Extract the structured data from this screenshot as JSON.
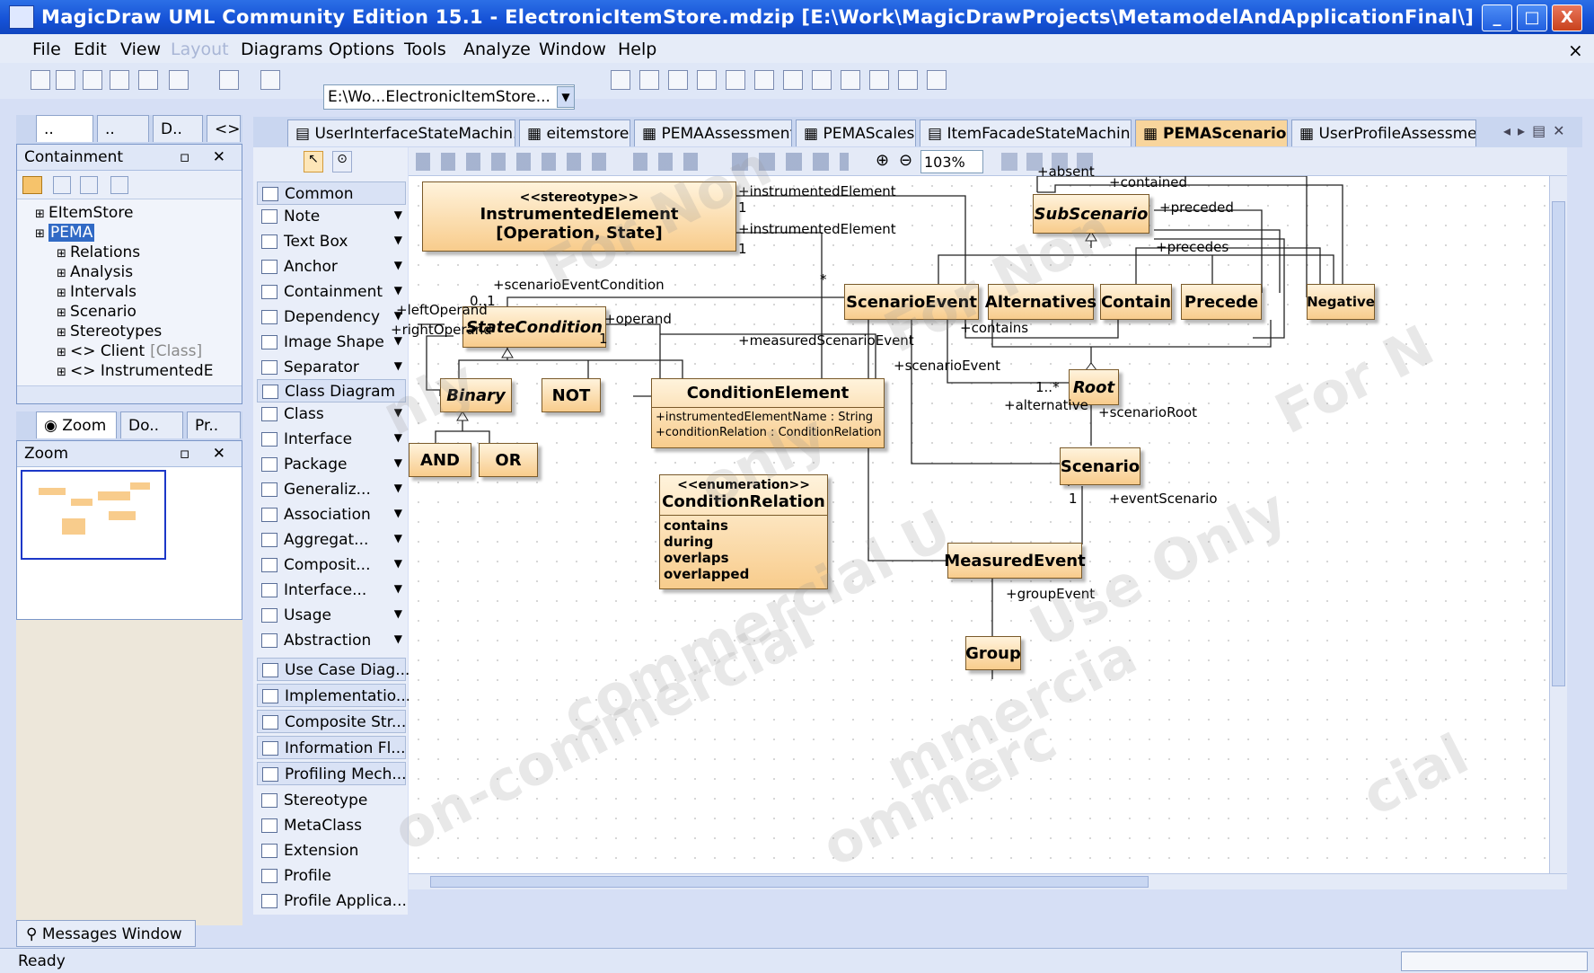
{
  "window": {
    "title": "MagicDraw UML Community Edition 15.1 - ElectronicItemStore.mdzip [E:\\Work\\MagicDrawProjects\\MetamodelAndApplicationFinal\\]",
    "minimize": "_",
    "maximize": "□",
    "close": "X"
  },
  "menu": [
    "File",
    "Edit",
    "View",
    "Layout",
    "Diagrams",
    "Options",
    "Tools",
    "Analyze",
    "Window",
    "Help"
  ],
  "menu_close": "×",
  "toolbar": {
    "project_path": "E:\\Wo...ElectronicItemStore..."
  },
  "left_tabs": [
    "..",
    "..",
    "D..",
    "<>"
  ],
  "containment": {
    "title": "Containment",
    "tree": [
      {
        "indent": 0,
        "label": "EItemStore",
        "selected": false
      },
      {
        "indent": 0,
        "label": "PEMA",
        "selected": true
      },
      {
        "indent": 1,
        "label": "Relations",
        "selected": false
      },
      {
        "indent": 1,
        "label": "Analysis",
        "selected": false
      },
      {
        "indent": 1,
        "label": "Intervals",
        "selected": false
      },
      {
        "indent": 1,
        "label": "Scenario",
        "selected": false
      },
      {
        "indent": 1,
        "label": "Stereotypes",
        "selected": false
      },
      {
        "indent": 1,
        "label": "<> Client",
        "suffix": "[Class]",
        "selected": false
      },
      {
        "indent": 1,
        "label": "<> InstrumentedE",
        "selected": false
      }
    ]
  },
  "zoom_tabs": [
    "Zoom",
    "Do..",
    "Pr.."
  ],
  "zoom_panel": {
    "title": "Zoom"
  },
  "diagram_tabs": [
    "UserInterfaceStateMachin...",
    "eitemstore",
    "PEMAAssessment",
    "PEMAScales",
    "ItemFacadeStateMachine",
    "PEMAScenario",
    "UserProfileAssessmer"
  ],
  "active_tab": "PEMAScenario",
  "zoom_level": "103%",
  "palette": {
    "common_header": "Common",
    "common": [
      "Note",
      "Text Box",
      "Anchor",
      "Containment",
      "Dependency",
      "Image Shape",
      "Separator"
    ],
    "class_header": "Class Diagram",
    "class_items": [
      "Class",
      "Interface",
      "Package",
      "Generaliz...",
      "Association",
      "Aggregat...",
      "Composit...",
      "Interface...",
      "Usage",
      "Abstraction"
    ],
    "groups": [
      "Use Case Diag...",
      "Implementatio...",
      "Composite Str...",
      "Information Fl...",
      "Profiling Mech..."
    ],
    "profile_items": [
      "Stereotype",
      "MetaClass",
      "Extension",
      "Profile",
      "Profile Applica..."
    ]
  },
  "diagram": {
    "classes": {
      "instrumented": {
        "stereo": "<<stereotype>>",
        "name": "InstrumentedElement",
        "sub": "[Operation, State]"
      },
      "stateCondition": "StateCondition",
      "binary": "Binary",
      "not": "NOT",
      "and": "AND",
      "or": "OR",
      "conditionElement": {
        "name": "ConditionElement",
        "attrs": [
          "+instrumentedElementName : String",
          "+conditionRelation : ConditionRelation"
        ]
      },
      "conditionRelation": {
        "stereo": "<<enumeration>>",
        "name": "ConditionRelation",
        "literals": [
          "contains",
          "during",
          "overlaps",
          "overlapped"
        ]
      },
      "subScenario": "SubScenario",
      "scenarioEvent": "ScenarioEvent",
      "alternatives": "Alternatives",
      "contain": "Contain",
      "precede": "Precede",
      "negative": "Negative",
      "root": "Root",
      "scenario": "Scenario",
      "measuredEvent": "MeasuredEvent",
      "group": "Group"
    },
    "labels": {
      "instrumentedElement1": "+instrumentedElement",
      "instrumentedElement2": "+instrumentedElement",
      "one": "1",
      "star": "*",
      "scenarioEventCondition": "+scenarioEventCondition",
      "zeroOne": "0..1",
      "leftOperand": "+leftOperand",
      "rightOperand": "+rightOperand",
      "operand": "+operand",
      "measuredScenarioEvent": "+measuredScenarioEvent",
      "absent": "+absent",
      "contained": "+contained",
      "preceded": "+preceded",
      "precedes": "+precedes",
      "contains": "+contains",
      "scenarioEvent": "+scenarioEvent",
      "alternative": "+alternative",
      "scenarioRoot": "+scenarioRoot",
      "eventScenario": "+eventScenario",
      "groupEvent": "+groupEvent",
      "oneStar": "1..*"
    },
    "watermarks": [
      "For Non",
      "For Non",
      "For N",
      "nly",
      "only",
      "Use Only",
      "commercial U",
      "on-commercial",
      "mmercia",
      "ommerc",
      "cial"
    ]
  },
  "messages_tab": "Messages Window",
  "status": "Ready"
}
